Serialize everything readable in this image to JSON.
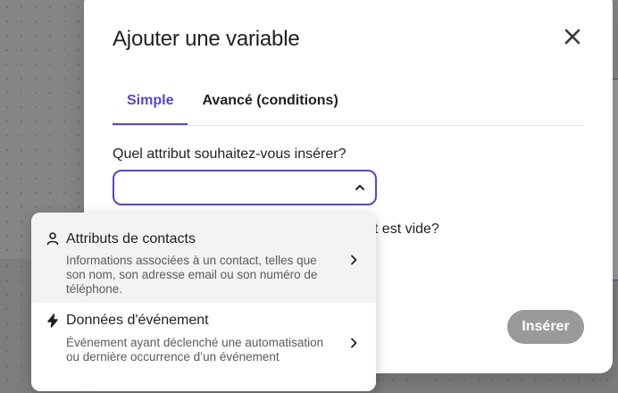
{
  "modal": {
    "title": "Ajouter une variable",
    "close_icon": "close-icon",
    "tabs": [
      {
        "label": "Simple",
        "active": true
      },
      {
        "label": "Avancé (conditions)",
        "active": false
      }
    ],
    "field_label": "Quel attribut souhaitez-vous insérer?",
    "select_value": "",
    "partial_question": "ut est vide?",
    "insert_label": "Insérer"
  },
  "dropdown": {
    "items": [
      {
        "icon": "person-icon",
        "title": "Attributs de contacts",
        "description": "Informations associées à un contact, telles que son nom, son adresse email ou son numéro de téléphone."
      },
      {
        "icon": "lightning-icon",
        "title": "Données d'événement",
        "description": "Événement ayant déclenché une automatisation ou dernière occurrence d’un événement"
      }
    ]
  },
  "colors": {
    "accent": "#5547c4",
    "overlay": "#858585",
    "button_disabled": "#9a9a9a",
    "hover_row": "#f3f3f3"
  }
}
